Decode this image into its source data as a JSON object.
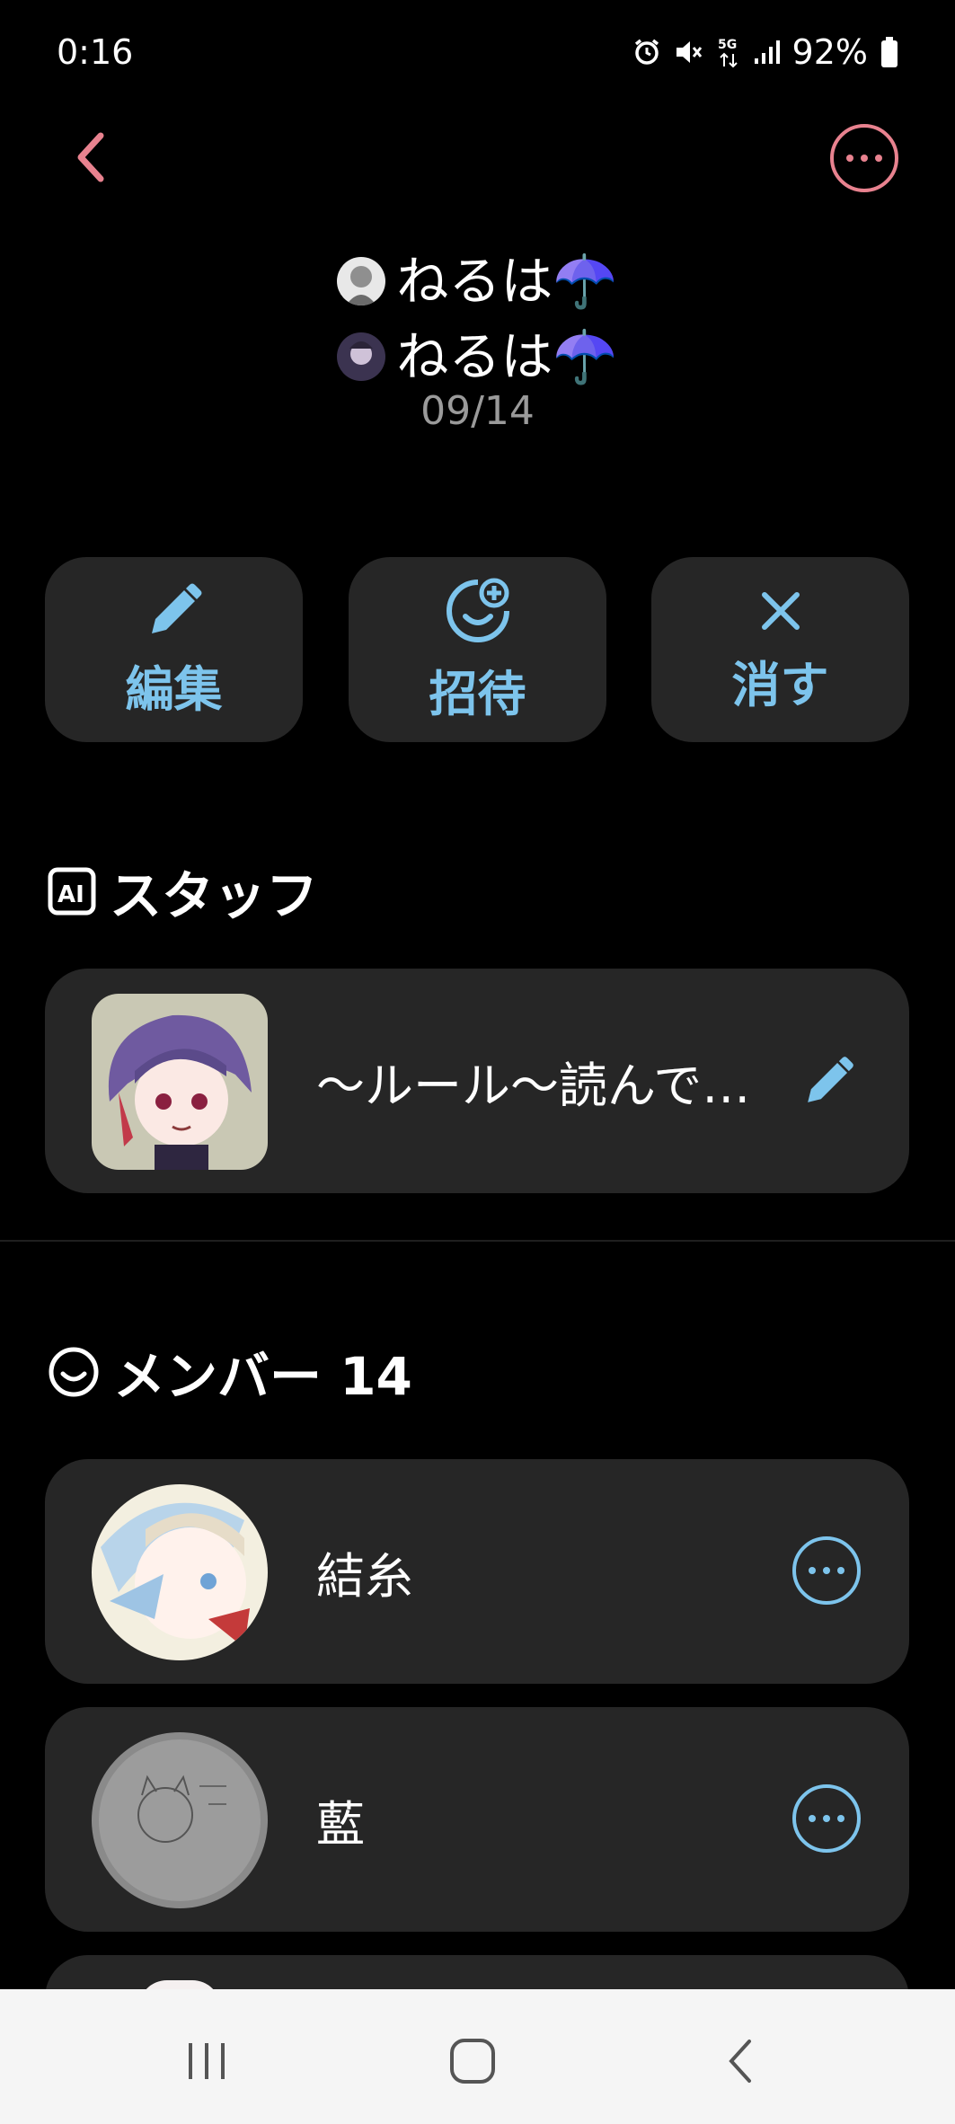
{
  "status_bar": {
    "time": "0:16",
    "battery": "92%"
  },
  "header": {
    "lines": [
      "ねるは☂️",
      "ねるは☂️"
    ],
    "date": "09/14"
  },
  "actions": {
    "edit_label": "編集",
    "invite_label": "招待",
    "delete_label": "消す"
  },
  "staff": {
    "title": "スタッフ",
    "item_text": "〜ルール〜読んで…"
  },
  "members": {
    "title": "メンバー 14",
    "items": [
      {
        "name": "結糸"
      },
      {
        "name": "藍"
      }
    ]
  },
  "colors": {
    "accent_pink": "#e8828f",
    "accent_blue": "#7dc4ec",
    "card_bg": "#262626"
  }
}
